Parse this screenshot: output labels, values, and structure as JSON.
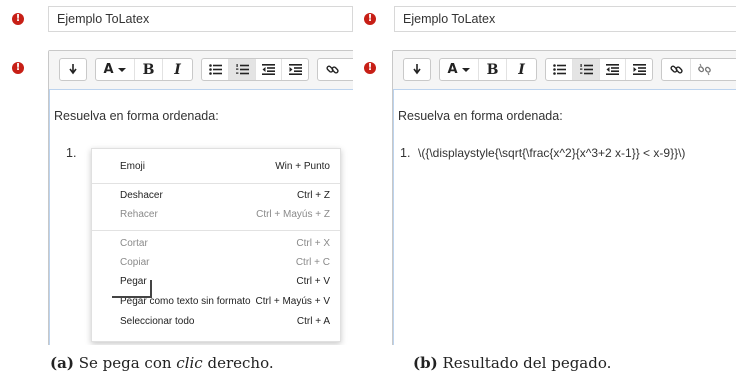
{
  "panel_a": {
    "name_value": "Ejemplo ToLatex",
    "body_text": "Resuelva en forma ordenada:",
    "list_marker": "1.",
    "context_menu": [
      {
        "label": "Emoji",
        "shortcut": "Win + Punto",
        "enabled": true
      },
      {
        "label": "Deshacer",
        "shortcut": "Ctrl + Z",
        "enabled": true
      },
      {
        "label": "Rehacer",
        "shortcut": "Ctrl + Mayús + Z",
        "enabled": false
      },
      {
        "label": "Cortar",
        "shortcut": "Ctrl + X",
        "enabled": false
      },
      {
        "label": "Copiar",
        "shortcut": "Ctrl + C",
        "enabled": false
      },
      {
        "label": "Pegar",
        "shortcut": "Ctrl + V",
        "enabled": true
      },
      {
        "label": "Pegar como texto sin formato",
        "shortcut": "Ctrl + Mayús + V",
        "enabled": true
      },
      {
        "label": "Seleccionar todo",
        "shortcut": "Ctrl + A",
        "enabled": true
      }
    ],
    "caption_letter": "(a)",
    "caption_before": "Se pega con",
    "caption_emph": "clic",
    "caption_after": "derecho."
  },
  "panel_b": {
    "name_value": "Ejemplo ToLatex",
    "body_text": "Resuelva en forma ordenada:",
    "list_marker": "1.",
    "list_item": "\\({\\displaystyle{\\sqrt{\\frac{x^2}{x^3+2 x-1}} < x-9}}\\)",
    "caption_letter": "(b)",
    "caption_text": "Resultado del pegado."
  },
  "toolbar": {
    "warning_glyph": "!",
    "font_letter": "A",
    "bold_label": "B",
    "italic_label": "I",
    "icons": [
      "undo-arrow-icon",
      "font-color-icon",
      "chevron-down-icon",
      "bold-icon",
      "italic-icon",
      "bullet-list-icon",
      "numbered-list-icon",
      "outdent-icon",
      "indent-icon",
      "link-icon",
      "unlink-icon"
    ]
  },
  "colors": {
    "warning": "#c71f16",
    "toolbar_bg": "#f5f5f5",
    "editor_focus": "#bcd3ee"
  }
}
